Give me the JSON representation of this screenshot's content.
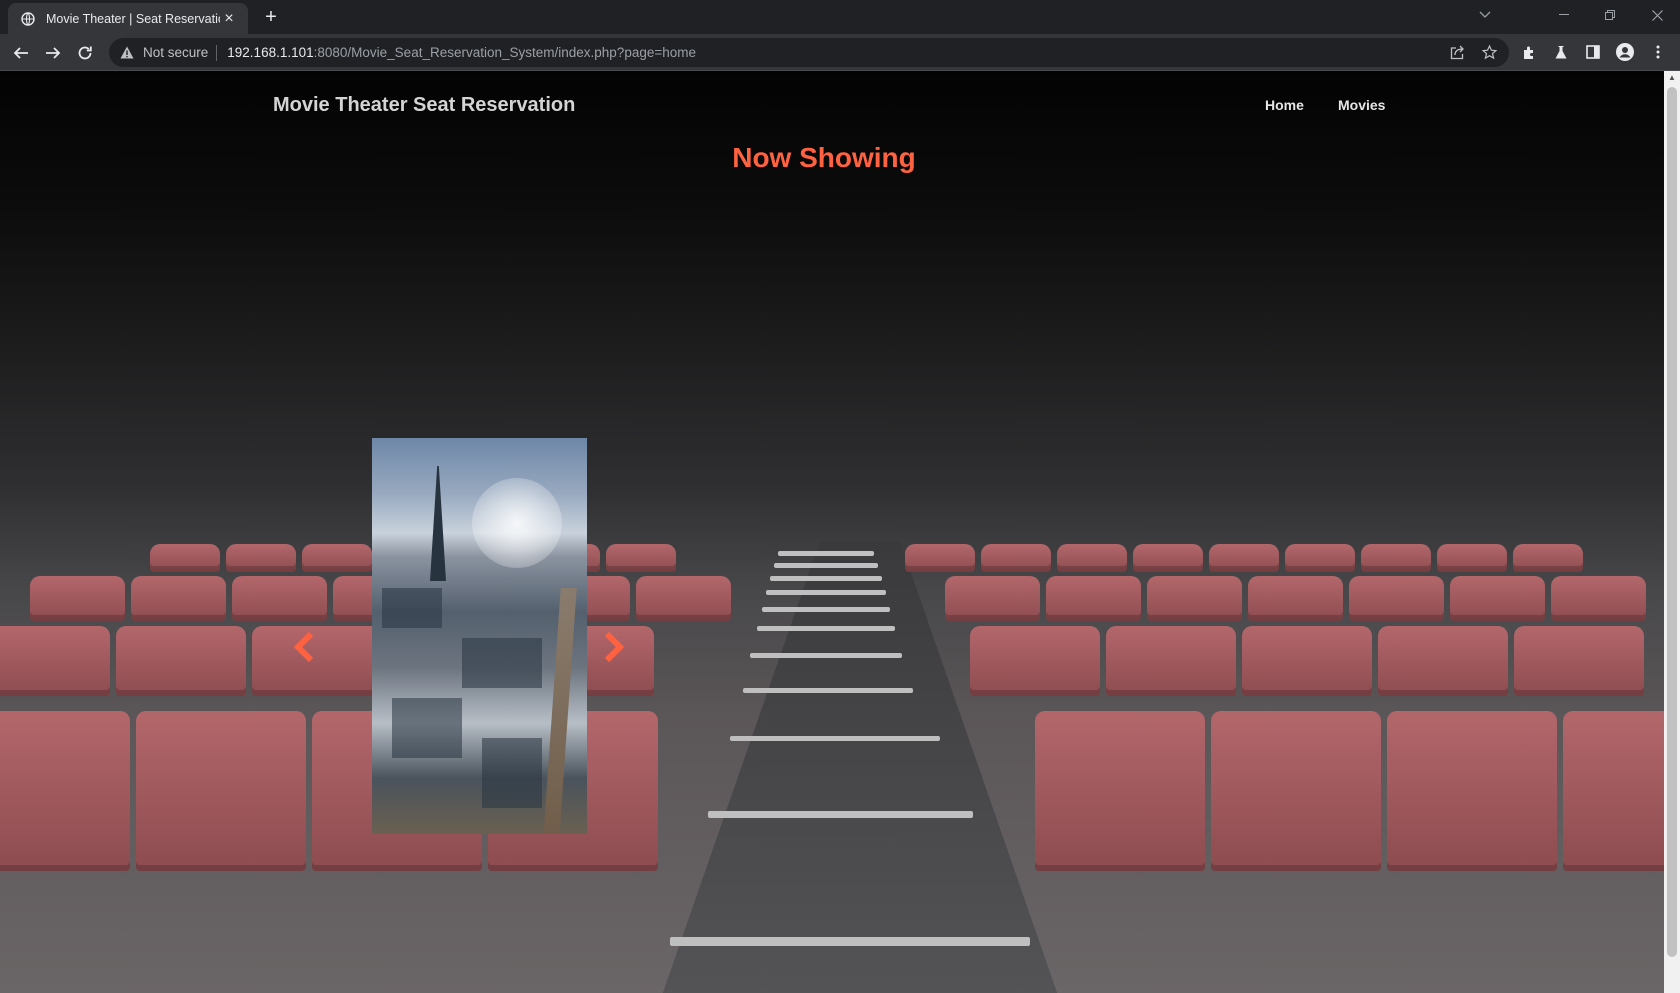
{
  "browser": {
    "tab_title": "Movie Theater | Seat Reservation",
    "omnibox": {
      "security_label": "Not secure",
      "host": "192.168.1.101",
      "path": ":8080/Movie_Seat_Reservation_System/index.php?page=home"
    }
  },
  "site": {
    "title": "Movie Theater Seat Reservation",
    "nav": [
      {
        "label": "Home"
      },
      {
        "label": "Movies"
      }
    ],
    "heading": "Now Showing"
  },
  "colors": {
    "accent": "#ff6240",
    "browser_bg": "#202124",
    "toolbar_bg": "#35363a"
  },
  "icons": {
    "tab": "globe-icon",
    "prev": "chevron-left-icon",
    "next": "chevron-right-icon"
  }
}
